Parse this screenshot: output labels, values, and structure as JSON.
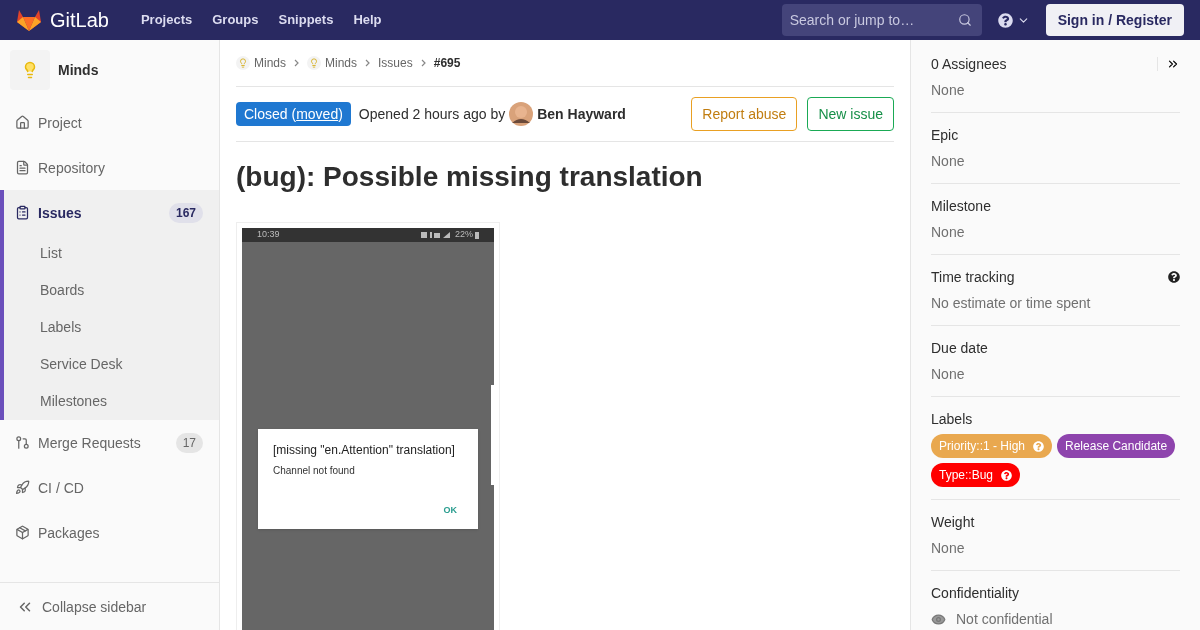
{
  "nav": {
    "brand": "GitLab",
    "links": [
      "Projects",
      "Groups",
      "Snippets",
      "Help"
    ],
    "search": {
      "placeholder": "Search or jump to…"
    },
    "signin": "Sign in / Register"
  },
  "sidebar": {
    "project": "Minds",
    "items": [
      {
        "kind": "home",
        "label": "Project",
        "selected": false
      },
      {
        "kind": "repo",
        "label": "Repository",
        "selected": false
      },
      {
        "kind": "issues",
        "label": "Issues",
        "count": "167",
        "selected": true,
        "children": [
          {
            "label": "List"
          },
          {
            "label": "Boards"
          },
          {
            "label": "Labels"
          },
          {
            "label": "Service Desk"
          },
          {
            "label": "Milestones"
          }
        ]
      },
      {
        "kind": "merge",
        "label": "Merge Requests",
        "count": "17",
        "selected": false
      },
      {
        "kind": "rocket",
        "label": "CI / CD",
        "selected": false
      },
      {
        "kind": "package",
        "label": "Packages",
        "selected": false
      }
    ],
    "collapse": "Collapse sidebar"
  },
  "breadcrumbs": [
    {
      "label": "Minds",
      "kind": "project"
    },
    {
      "label": "Minds",
      "kind": "project"
    },
    {
      "label": "Issues",
      "kind": "page"
    },
    {
      "label": "#695",
      "kind": "page"
    }
  ],
  "status": {
    "before": "Closed (",
    "link": "moved",
    "after": ")"
  },
  "opened": "Opened 2 hours ago by",
  "author": "Ben Hayward",
  "actions": [
    {
      "kind": "warning",
      "label": "Report abuse"
    },
    {
      "kind": "success",
      "label": "New issue"
    }
  ],
  "title": "(bug): Possible missing translation",
  "attachment": {
    "time": "10:39",
    "battery": "22%",
    "dialog_title": "[missing \"en.Attention\" translation]",
    "dialog_message": "Channel not found",
    "dialog_button": "OK"
  },
  "details": [
    {
      "title": "0 Assignees",
      "value": "None",
      "collapse": true
    },
    {
      "title": "Epic",
      "value": "None"
    },
    {
      "title": "Milestone",
      "value": "None"
    },
    {
      "title": "Time tracking",
      "value": "No estimate or time spent",
      "help": true
    },
    {
      "title": "Due date",
      "value": "None"
    },
    {
      "title": "Labels",
      "labels": [
        {
          "text": "Priority::1 - High",
          "color": "#e9a84f",
          "scoped": true
        },
        {
          "text": "Release Candidate",
          "color": "#8e44ad",
          "scoped": false
        },
        {
          "text": "Type::Bug",
          "color": "#ff0000",
          "scoped": true
        }
      ]
    },
    {
      "title": "Weight",
      "value": "None"
    },
    {
      "title": "Confidentiality",
      "value": "Not confidential",
      "kind": "eye"
    }
  ]
}
